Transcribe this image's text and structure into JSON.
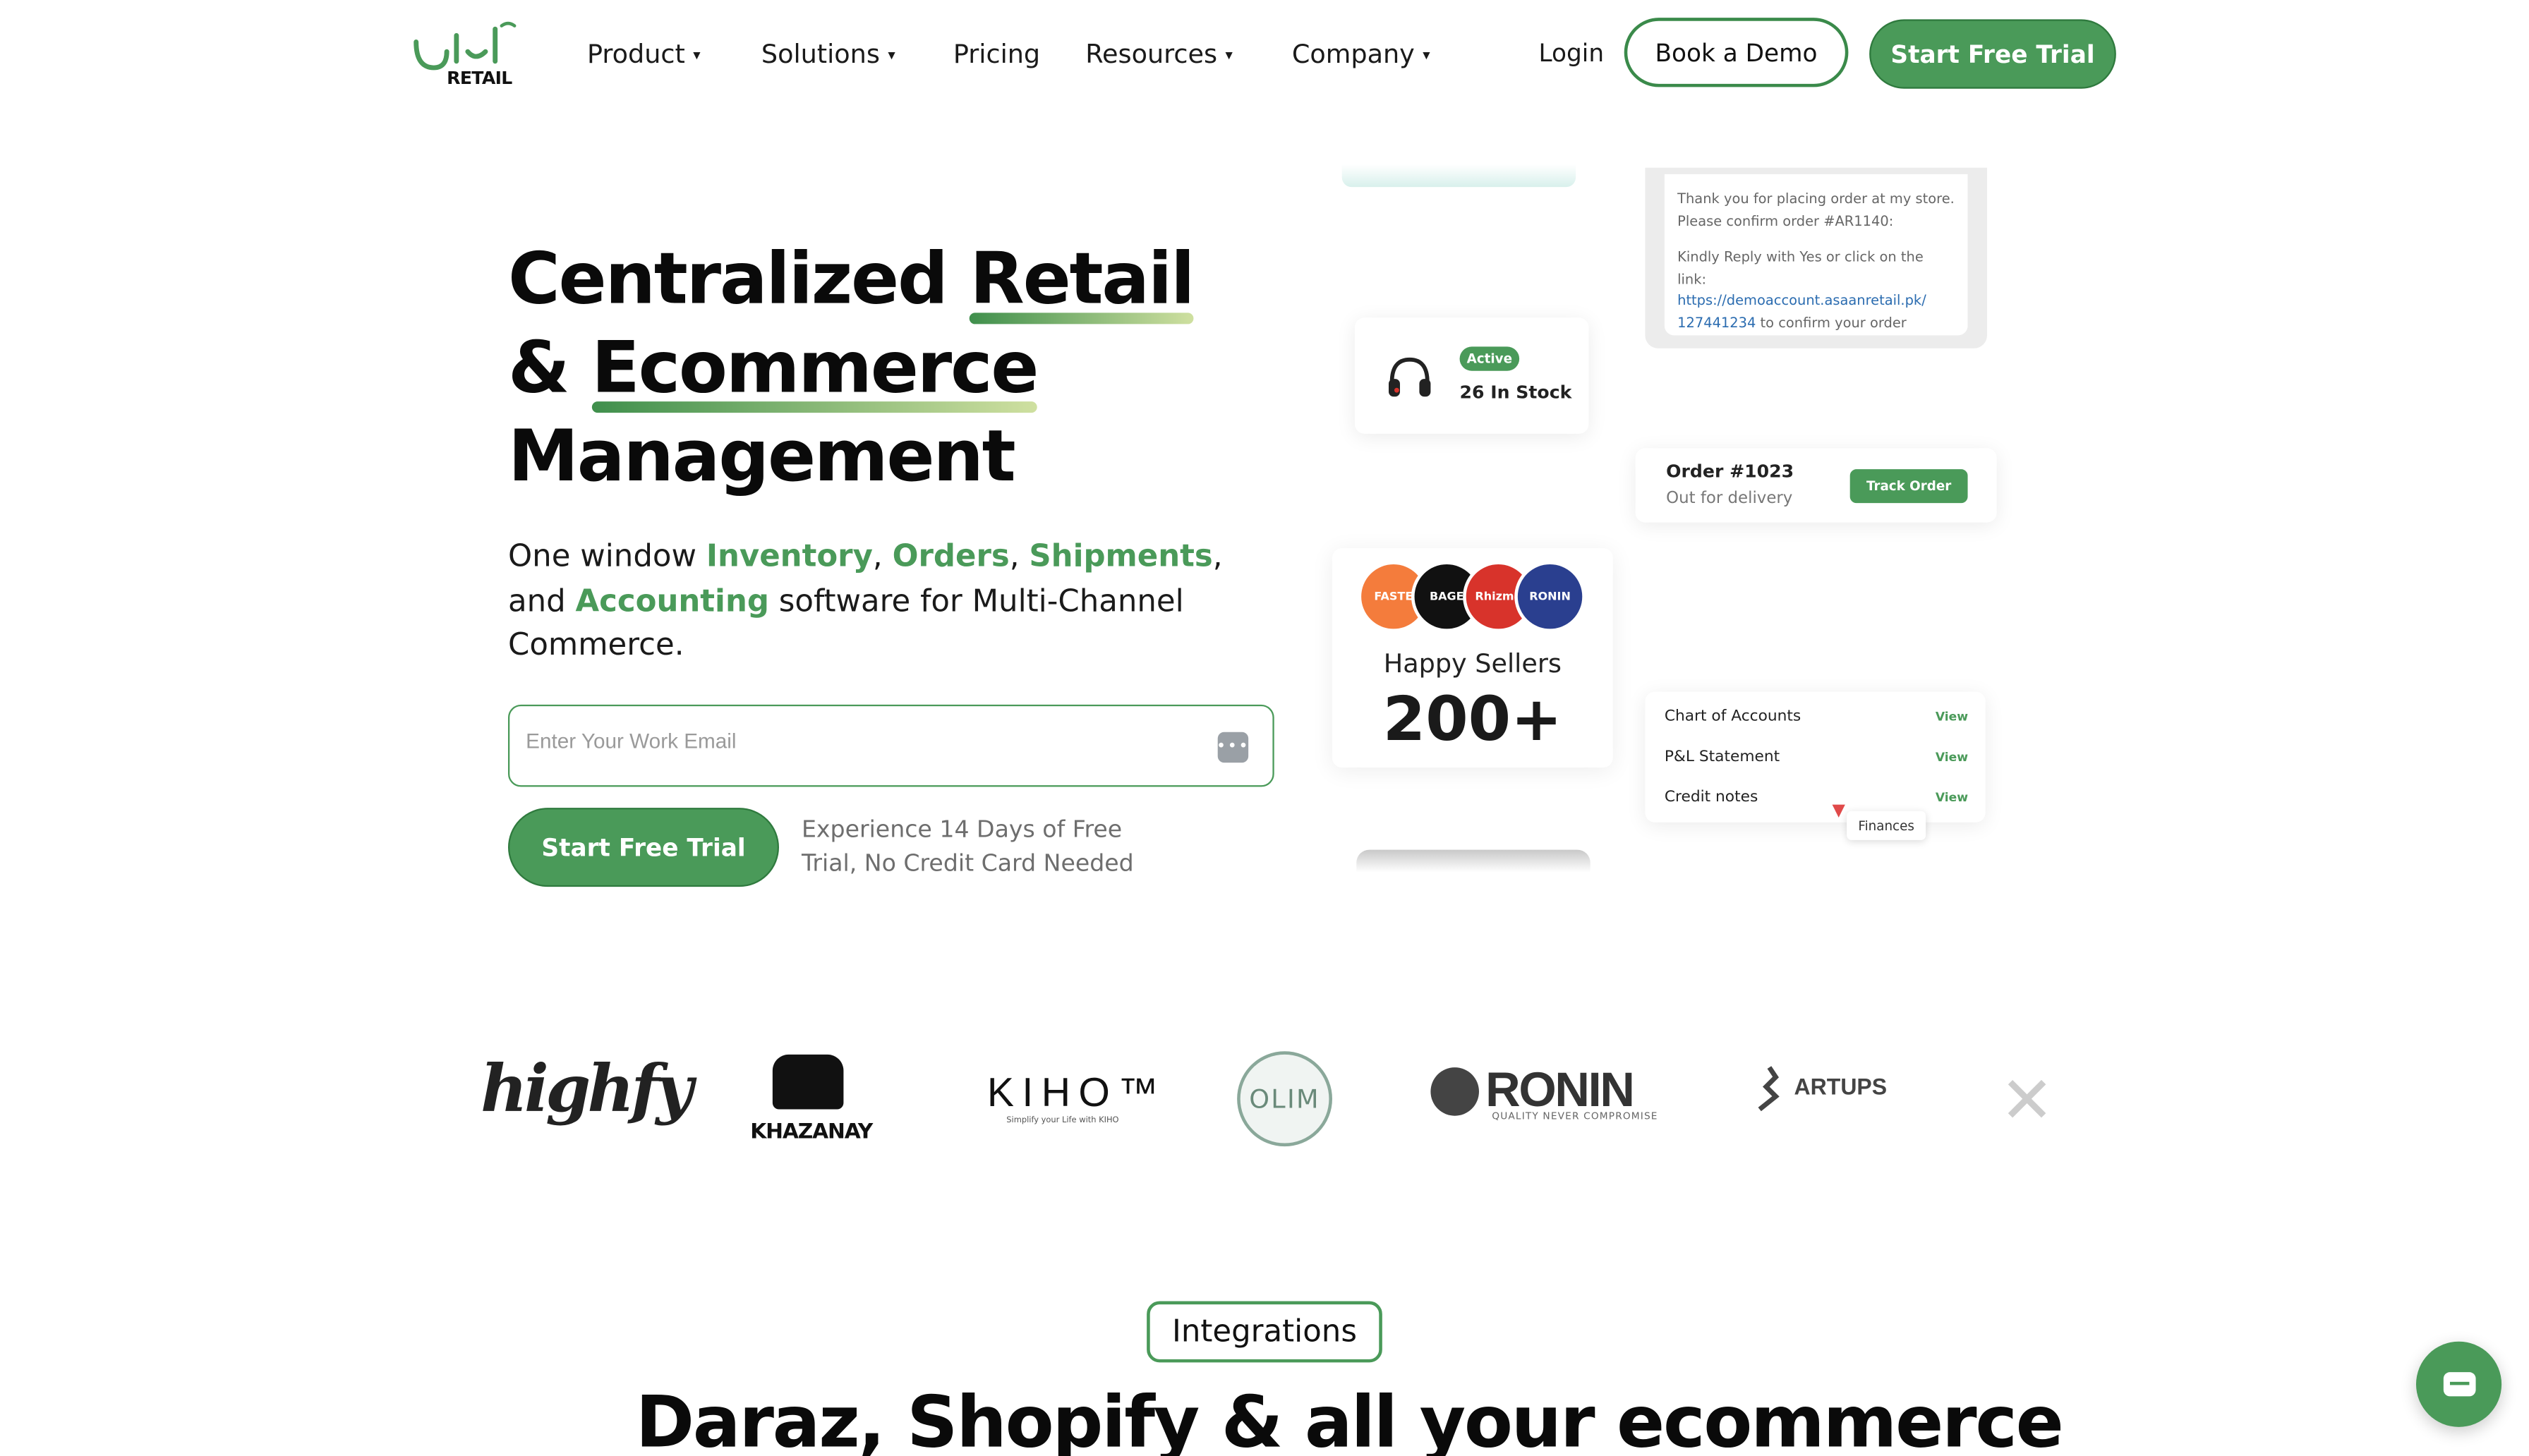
{
  "nav": {
    "logo_text": "RETAIL",
    "logo_urdu": "آسان",
    "items": [
      {
        "label": "Product",
        "has_dropdown": true
      },
      {
        "label": "Solutions",
        "has_dropdown": true
      },
      {
        "label": "Pricing",
        "has_dropdown": false
      },
      {
        "label": "Resources",
        "has_dropdown": true
      },
      {
        "label": "Company",
        "has_dropdown": true
      }
    ],
    "login": "Login",
    "book_demo": "Book a Demo",
    "start_trial": "Start Free Trial"
  },
  "hero": {
    "title_line1_a": "Centralized ",
    "title_line1_b": "Retail",
    "title_line2_a": "& ",
    "title_line2_b": "Ecommerce",
    "title_line3": "Management",
    "sub_1": "One window ",
    "sub_inventory": "Inventory",
    "sub_comma1": ", ",
    "sub_orders": "Orders",
    "sub_comma2": ", ",
    "sub_shipments": "Shipments",
    "sub_and": ", and ",
    "sub_accounting": "Accounting",
    "sub_2": " software for Multi-Channel Commerce.",
    "email_placeholder": "Enter Your Work Email",
    "cta": "Start Free Trial",
    "note": "Experience 14 Days of Free Trial, No Credit Card Needed"
  },
  "cards": {
    "stock": {
      "badge": "Active",
      "text": "26 In Stock"
    },
    "message": {
      "line1": "Thank you for placing order at my store.",
      "line2": "Please confirm order #AR1140:",
      "line3": "Kindly Reply with Yes or click on the link:",
      "link1": "https://demoaccount.asaanretail.pk/",
      "link2": "127441234",
      "line4": " to confirm your order"
    },
    "order": {
      "id": "Order #1023",
      "status": "Out for delivery",
      "button": "Track Order"
    },
    "sellers": {
      "avatars": [
        {
          "label": "FASTE",
          "color": "#f47c3c"
        },
        {
          "label": "BAGE",
          "color": "#111111"
        },
        {
          "label": "Rhizma",
          "color": "#d8332b"
        },
        {
          "label": "RONIN",
          "color": "#2a3f8f"
        }
      ],
      "label": "Happy Sellers",
      "count": "200+"
    },
    "finances": {
      "rows": [
        {
          "label": "Chart of Accounts",
          "action": "View"
        },
        {
          "label": "P&L Statement",
          "action": "View"
        },
        {
          "label": "Credit notes",
          "action": "View"
        }
      ],
      "tag": "Finances"
    }
  },
  "brands": {
    "highfy": "highfy",
    "khazanay": "KHAZANAY",
    "kiho": "KIHO™",
    "kiho_sub": "Simplify your Life with KIHO",
    "olim": "OLIM",
    "ronin": "RONIN",
    "ronin_sub": "QUALITY NEVER COMPROMISE",
    "artups": "ARTUPS"
  },
  "integrations": {
    "pill": "Integrations",
    "title": "Daraz, Shopify & all your ecommerce"
  }
}
